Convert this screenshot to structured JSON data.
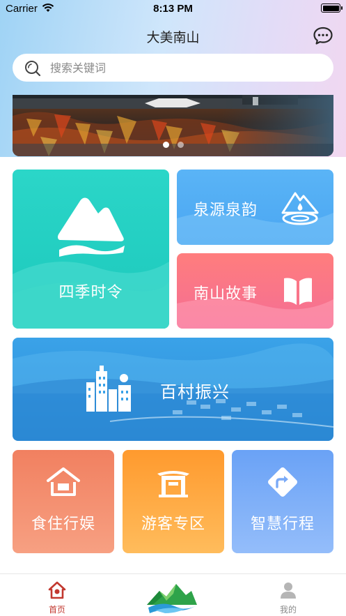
{
  "status_bar": {
    "carrier": "Carrier",
    "time": "8:13 PM"
  },
  "header": {
    "title": "大美南山",
    "message_icon": "chat-bubble-icon"
  },
  "search": {
    "placeholder": "搜索关键词"
  },
  "banner": {
    "slide_count": 2,
    "active_index": 0
  },
  "features": {
    "seasons": "四季时令",
    "spring": "泉源泉韵",
    "story": "南山故事",
    "village": "百村振兴",
    "food": "食住行娱",
    "tourist": "游客专区",
    "trip": "智慧行程"
  },
  "tabbar": {
    "home": "首页",
    "mine": "我的",
    "active_color": "#c2382f",
    "inactive_color": "#8a8a8a"
  }
}
